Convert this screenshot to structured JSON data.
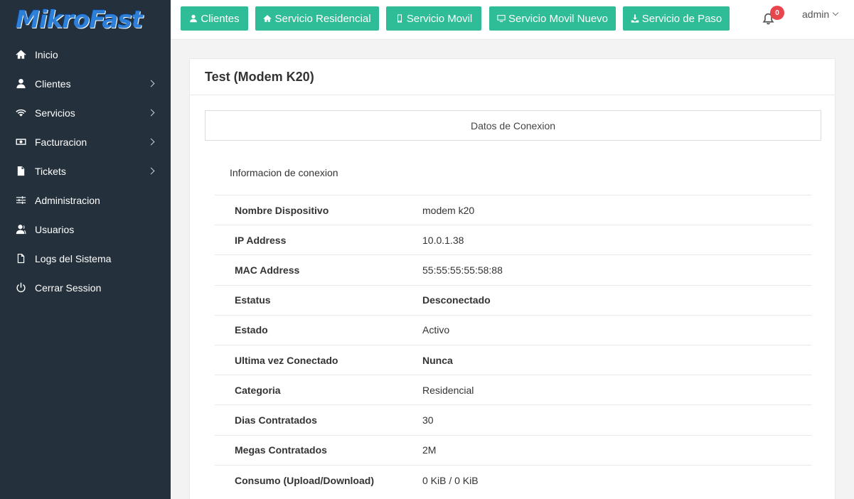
{
  "brand": {
    "logo_text": "MikroFast",
    "logo_color": "#2d7fd8"
  },
  "sidebar": {
    "items": [
      {
        "label": "Inicio",
        "icon": "home-icon",
        "has_submenu": false
      },
      {
        "label": "Clientes",
        "icon": "user-icon",
        "has_submenu": true
      },
      {
        "label": "Servicios",
        "icon": "wifi-icon",
        "has_submenu": true
      },
      {
        "label": "Facturacion",
        "icon": "money-icon",
        "has_submenu": true
      },
      {
        "label": "Tickets",
        "icon": "file-icon",
        "has_submenu": true
      },
      {
        "label": "Administracion",
        "icon": "sliders-icon",
        "has_submenu": false
      },
      {
        "label": "Usuarios",
        "icon": "users-icon",
        "has_submenu": false
      },
      {
        "label": "Logs del Sistema",
        "icon": "document-icon",
        "has_submenu": false
      },
      {
        "label": "Cerrar Session",
        "icon": "power-icon",
        "has_submenu": false
      }
    ]
  },
  "topbar": {
    "buttons": [
      {
        "label": "Clientes",
        "icon": "user-icon"
      },
      {
        "label": "Servicio Residencial",
        "icon": "home-icon"
      },
      {
        "label": "Servicio Movil",
        "icon": "mobile-icon"
      },
      {
        "label": "Servicio Movil Nuevo",
        "icon": "monitor-icon"
      },
      {
        "label": "Servicio de Paso",
        "icon": "download-icon"
      }
    ],
    "notifications_count": "0",
    "user": "admin",
    "accent_color": "#2ebd96"
  },
  "main": {
    "title": "Test (Modem K20)",
    "tab": "Datos de Conexion",
    "section_title": "Informacion de conexion",
    "rows": [
      {
        "label": "Nombre Dispositivo",
        "value": "modem k20",
        "status": "normal"
      },
      {
        "label": "IP Address",
        "value": "10.0.1.38",
        "status": "normal"
      },
      {
        "label": "MAC Address",
        "value": "55:55:55:55:58:88",
        "status": "normal"
      },
      {
        "label": "Estatus",
        "value": "Desconectado",
        "status": "red"
      },
      {
        "label": "Estado",
        "value": "Activo",
        "status": "green"
      },
      {
        "label": "Ultima vez Conectado",
        "value": "Nunca",
        "status": "orange"
      },
      {
        "label": "Categoria",
        "value": "Residencial",
        "status": "normal"
      },
      {
        "label": "Dias Contratados",
        "value": "30",
        "status": "normal"
      },
      {
        "label": "Megas Contratados",
        "value": "2M",
        "status": "normal"
      },
      {
        "label": "Consumo (Upload/Download)",
        "value": "0 KiB / 0 KiB",
        "status": "normal"
      }
    ]
  }
}
